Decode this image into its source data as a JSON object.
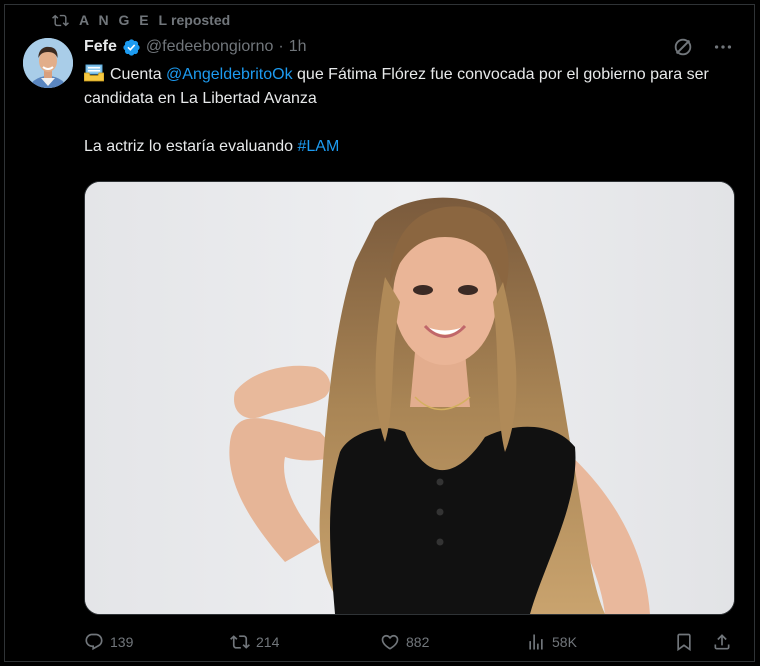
{
  "repost": {
    "name": "A N G E L",
    "suffix": "reposted",
    "icon": "retweet-icon"
  },
  "author": {
    "display_name": "Fefe",
    "verified": true,
    "handle": "@fedeebongiorno",
    "separator": "·",
    "time": "1h"
  },
  "tweet": {
    "emoji": "inbox-tray-emoji",
    "text_prefix": "Cuenta ",
    "mention": "@AngeldebritoOk",
    "text_suffix": " que Fátima Flórez fue convocada por el gobierno para ser candidata en La Libertad Avanza",
    "line2_prefix": "La actriz lo estaría evaluando ",
    "hashtag": "#LAM"
  },
  "actions": {
    "replies": "139",
    "retweets": "214",
    "likes": "882",
    "views": "58K"
  },
  "icons": [
    "retweet-icon",
    "verified-badge-icon",
    "grok-icon",
    "more-icon",
    "reply-icon",
    "like-icon",
    "views-icon",
    "bookmark-icon",
    "share-icon"
  ],
  "colors": {
    "background": "#000000",
    "text": "#e7e9ea",
    "muted": "#71767b",
    "link": "#1d9bf0",
    "verified": "#1d9bf0",
    "border": "#2f3336"
  }
}
